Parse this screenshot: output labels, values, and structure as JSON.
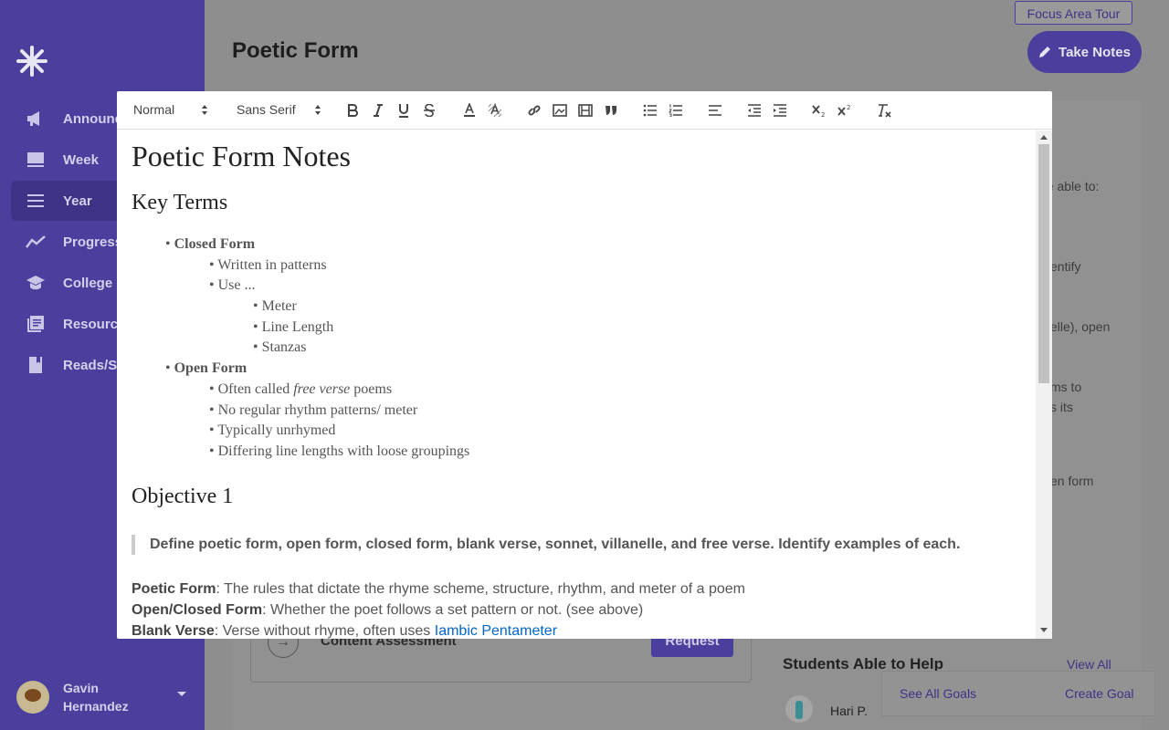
{
  "sidebar": {
    "items": [
      {
        "label": "Announcements"
      },
      {
        "label": "Week"
      },
      {
        "label": "Year"
      },
      {
        "label": "Progress"
      },
      {
        "label": "College"
      },
      {
        "label": "Resources"
      },
      {
        "label": "Reads/Search"
      }
    ],
    "user": {
      "name": "Gavin Hernandez"
    }
  },
  "page": {
    "tour_label": "Focus Area Tour",
    "title": "Poetic Form",
    "take_notes_label": "Take Notes",
    "peek_1": "be able to:",
    "peek_2": "entify",
    "peek_3": "elle), open",
    "peek_4": "ms to",
    "peek_5": "s its",
    "peek_6": "en form",
    "assessment_label": "Content Assessment",
    "request_label": "Request",
    "help_title": "Students Able to Help",
    "view_all_label": "View All",
    "student_name": "Hari P.",
    "see_all_goals": "See All Goals",
    "create_goal": "Create Goal"
  },
  "toolbar": {
    "heading_select": "Normal",
    "font_select": "Sans Serif"
  },
  "document": {
    "title": "Poetic Form Notes",
    "key_terms_heading": "Key Terms",
    "closed_form": "Closed Form",
    "closed_1": "Written in patterns",
    "closed_2": "Use ...",
    "closed_2a": "Meter",
    "closed_2b": "Line Length",
    "closed_2c": "Stanzas",
    "open_form": "Open Form",
    "open_1_pre": "Often called ",
    "open_1_em": "free verse",
    "open_1_post": " poems",
    "open_2": "No regular rhythm patterns/ meter",
    "open_3": "Typically unrhymed",
    "open_4": "Differing line lengths with loose groupings",
    "objective_heading": "Objective 1",
    "objective_quote": "Define poetic form, open form, closed form, blank verse, sonnet, villanelle, and free verse. Identify examples of each.",
    "def_1_term": "Poetic Form",
    "def_1_text": ": The rules that dictate the rhyme scheme, structure, rhythm, and meter of a poem",
    "def_2_term": "Open/Closed Form",
    "def_2_text": ": Whether the poet follows a set pattern or not. (see above)",
    "def_3_term": "Blank Verse",
    "def_3_text": ": Verse without rhyme, often uses ",
    "def_3_link": "Iambic Pentameter"
  },
  "colors": {
    "sidebar": "#4a3f9c",
    "accent": "#4a3f9c",
    "link": "#0066cc"
  }
}
